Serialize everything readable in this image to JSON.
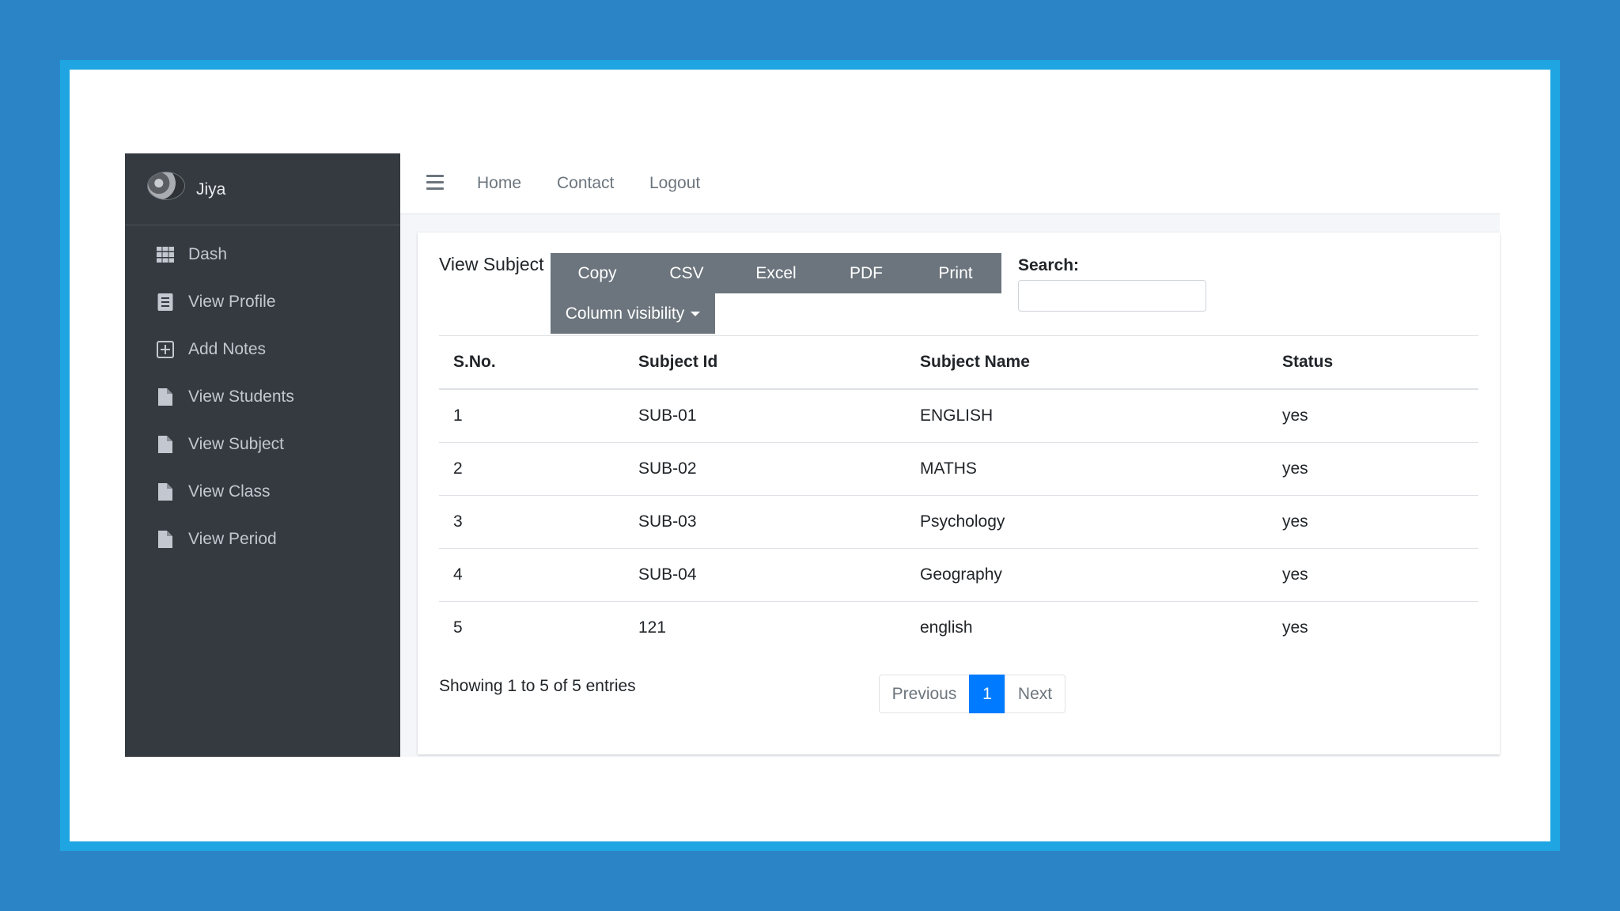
{
  "user": {
    "name": "Jiya"
  },
  "sidebar": {
    "items": [
      {
        "label": "Dash",
        "icon": "grid-icon"
      },
      {
        "label": "View Profile",
        "icon": "address-book-icon"
      },
      {
        "label": "Add Notes",
        "icon": "plus-square-icon"
      },
      {
        "label": "View Students",
        "icon": "file-icon"
      },
      {
        "label": "View Subject",
        "icon": "file-icon"
      },
      {
        "label": "View Class",
        "icon": "file-icon"
      },
      {
        "label": "View Period",
        "icon": "file-icon"
      }
    ]
  },
  "topnav": {
    "home": "Home",
    "contact": "Contact",
    "logout": "Logout"
  },
  "card": {
    "title": "View Subject"
  },
  "buttons": {
    "copy": "Copy",
    "csv": "CSV",
    "excel": "Excel",
    "pdf": "PDF",
    "print": "Print",
    "colvis": "Column visibility"
  },
  "search": {
    "label": "Search:",
    "value": "",
    "placeholder": ""
  },
  "table": {
    "headers": [
      "S.No.",
      "Subject Id",
      "Subject Name",
      "Status"
    ],
    "rows": [
      [
        "1",
        "SUB-01",
        "ENGLISH",
        "yes"
      ],
      [
        "2",
        "SUB-02",
        "MATHS",
        "yes"
      ],
      [
        "3",
        "SUB-03",
        "Psychology",
        "yes"
      ],
      [
        "4",
        "SUB-04",
        "Geography",
        "yes"
      ],
      [
        "5",
        "121",
        "english",
        "yes"
      ]
    ]
  },
  "info": "Showing 1 to 5 of 5 entries",
  "pagination": {
    "previous": "Previous",
    "current": "1",
    "next": "Next"
  },
  "colors": {
    "background": "#2a84c6",
    "frame": "#1ea5e2",
    "sidebar": "#343a40",
    "button": "#6c757d",
    "active_page": "#007bff"
  }
}
